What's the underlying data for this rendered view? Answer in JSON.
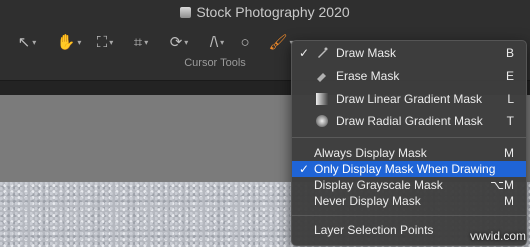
{
  "app": {
    "title": "Stock Photography 2020"
  },
  "toolbar": {
    "caption": "Cursor Tools",
    "tools": [
      {
        "name": "pointer",
        "glyph": "↖"
      },
      {
        "name": "hand",
        "glyph": "✋"
      },
      {
        "name": "perspective",
        "glyph": "⛶"
      },
      {
        "name": "crop",
        "glyph": "⌗"
      },
      {
        "name": "rotate",
        "glyph": "⟳"
      },
      {
        "name": "straighten",
        "glyph": "/\\"
      },
      {
        "name": "spot",
        "glyph": "○"
      },
      {
        "name": "brush",
        "glyph": "🖌"
      }
    ]
  },
  "menu": {
    "items": [
      {
        "label": "Draw Mask",
        "shortcut": "B",
        "checked": "✓",
        "icon": "brush-icon"
      },
      {
        "label": "Erase Mask",
        "shortcut": "E",
        "icon": "eraser-icon"
      },
      {
        "label": "Draw Linear Gradient Mask",
        "shortcut": "L",
        "icon": "linear-gradient-icon"
      },
      {
        "label": "Draw Radial Gradient Mask",
        "shortcut": "T",
        "icon": "radial-gradient-icon"
      },
      {
        "label": "Always Display Mask",
        "shortcut": "M"
      },
      {
        "label": "Only Display Mask When Drawing",
        "shortcut": "",
        "checked": "✓",
        "highlighted": true
      },
      {
        "label": "Display Grayscale Mask",
        "shortcut": "⌥M"
      },
      {
        "label": "Never Display Mask",
        "shortcut": "M"
      },
      {
        "label": "Layer Selection Points",
        "shortcut": ""
      }
    ]
  },
  "watermark": "vwvid.com",
  "colors": {
    "highlight": "#1f64d6",
    "active_tool": "#f08a2a"
  }
}
